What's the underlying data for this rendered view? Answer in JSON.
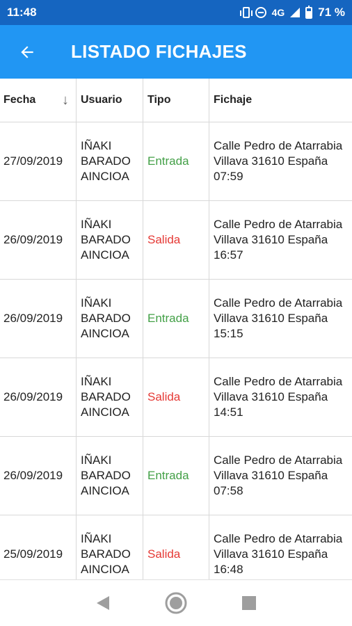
{
  "status": {
    "time": "11:48",
    "network": "4G",
    "battery_percent": "71 %"
  },
  "app_bar": {
    "title": "LISTADO FICHAJES"
  },
  "table": {
    "headers": {
      "fecha": "Fecha",
      "usuario": "Usuario",
      "tipo": "Tipo",
      "fichaje": "Fichaje"
    },
    "rows": [
      {
        "fecha": "27/09/2019",
        "usuario": "IÑAKI\nBARADO\nAINCIOA",
        "tipo": "Entrada",
        "fichaje": "Calle Pedro de Atarrabia\nVillava 31610 España\n07:59"
      },
      {
        "fecha": "26/09/2019",
        "usuario": "IÑAKI\nBARADO\nAINCIOA",
        "tipo": "Salida",
        "fichaje": "Calle Pedro de Atarrabia\nVillava 31610 España\n16:57"
      },
      {
        "fecha": "26/09/2019",
        "usuario": "IÑAKI\nBARADO\nAINCIOA",
        "tipo": "Entrada",
        "fichaje": "Calle Pedro de Atarrabia\nVillava 31610 España\n15:15"
      },
      {
        "fecha": "26/09/2019",
        "usuario": "IÑAKI\nBARADO\nAINCIOA",
        "tipo": "Salida",
        "fichaje": "Calle Pedro de Atarrabia\nVillava 31610 España\n14:51"
      },
      {
        "fecha": "26/09/2019",
        "usuario": "IÑAKI\nBARADO\nAINCIOA",
        "tipo": "Entrada",
        "fichaje": "Calle Pedro de Atarrabia\nVillava 31610 España\n07:58"
      },
      {
        "fecha": "25/09/2019",
        "usuario": "IÑAKI\nBARADO\nAINCIOA",
        "tipo": "Salida",
        "fichaje": "Calle Pedro de Atarrabia\nVillava 31610 España\n16:48"
      }
    ]
  },
  "colors": {
    "status_bar": "#1565c0",
    "app_bar": "#2196f3",
    "entrada": "#43a047",
    "salida": "#e53935"
  },
  "icons": {
    "back": "arrow-back-icon",
    "sort": "arrow-down-icon",
    "nav_back": "triangle-back-icon",
    "nav_home": "circle-home-icon",
    "nav_recents": "square-recents-icon"
  }
}
